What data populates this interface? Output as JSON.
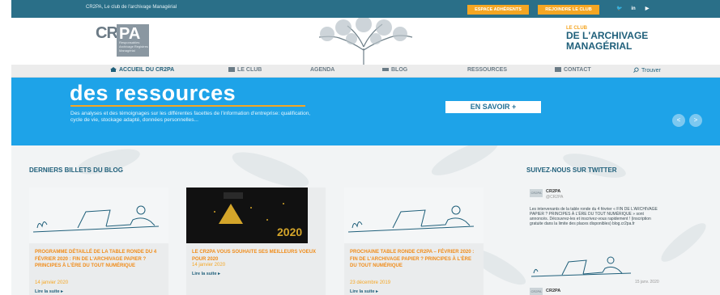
{
  "topbar": {
    "tagline": "CR2PA, Le club de l'archivage Managérial",
    "buttons": {
      "adherents": "ESPACE ADHÉRENTS",
      "join": "REJOINDRE LE CLUB"
    },
    "social": [
      "twitter-icon",
      "linkedin-icon",
      "youtube-icon"
    ],
    "social_glyphs": {
      "twitter": "🐦",
      "linkedin": "in",
      "youtube": "▶"
    }
  },
  "header": {
    "logo_text": "CR",
    "logo_text2": "PA",
    "logo_sub": "Responsables Archivage Registres Managérial",
    "club_small": "LE CLUB",
    "club_line1": "DE L'ARCHIVAGE",
    "club_line2": "MANAGÉRIAL"
  },
  "nav": {
    "home": "ACCUEIL DU CR2PA",
    "club": "LE CLUB",
    "agenda": "AGENDA",
    "blog": "BLOG",
    "ressources": "RESSOURCES",
    "contact": "CONTACT",
    "search": "Trouver"
  },
  "hero": {
    "title": "des ressources",
    "text": "Des analyses et des témoignages sur les différentes facettes de l'information d'entreprise: qualification, cycle de vie, stockage adapté, données personnelles...",
    "button": "EN SAVOIR +",
    "prev": "<",
    "next": ">"
  },
  "blog": {
    "section_title": "DERNIERS BILLETS DU BLOG",
    "posts": [
      {
        "title": "PROGRAMME DÉTAILLÉ DE LA TABLE RONDE DU 4 FÉVRIER 2020 : FIN DE L'ARCHIVAGE PAPIER ? PRINCIPES À L'ÈRE DU TOUT NUMÉRIQUE",
        "date": "14 janvier 2020",
        "more": "Lire la suite ▸"
      },
      {
        "title": "LE CR2PA VOUS SOUHAITE SES MEILLEURS VOEUX POUR 2020",
        "date": "14 janvier 2020",
        "more": "Lire la suite ▸",
        "image_caption": "2020"
      },
      {
        "title": "PROCHAINE TABLE RONDE CR2PA – FÉVRIER 2020 : FIN DE L'ARCHIVAGE PAPIER ? PRINCIPES À L'ÈRE DU TOUT NUMÉRIQUE",
        "date": "23 décembre 2019",
        "more": "Lire la suite ▸"
      }
    ]
  },
  "twitter": {
    "section_title": "SUIVEZ-NOUS SUR TWITTER",
    "name": "CR2PA",
    "handle": "@CR2PA",
    "text": "Les intervenants de la table ronde du 4 février « FIN DE L'ARCHIVAGE PAPIER ? PRINCIPES À L'ÈRE DU TOUT NUMÉRIQUE » sont annoncés. Découvrez-les et inscrivez-vous rapidement ! (inscription gratuite dans la limite des places disponibles) blog.cr2pa.fr",
    "date": "15 janv. 2020",
    "name2": "CR2PA",
    "avatar": "CR2PA"
  },
  "colors": {
    "topbar": "#2a6f88",
    "accent_orange": "#f5a623",
    "hero_blue": "#1ea3e8",
    "title_blue": "#1f5f7a"
  }
}
